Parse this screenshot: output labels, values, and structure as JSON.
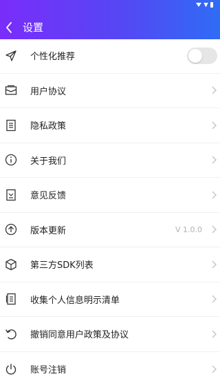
{
  "header": {
    "title": "设置",
    "background": "#5547f4"
  },
  "settings": {
    "items": [
      {
        "label": "个性化推荐",
        "icon": "paper-plane-icon",
        "control": "toggle",
        "toggle_on": false
      },
      {
        "label": "用户协议",
        "icon": "envelope-icon",
        "control": "chevron"
      },
      {
        "label": "隐私政策",
        "icon": "document-icon",
        "control": "chevron"
      },
      {
        "label": "关于我们",
        "icon": "info-icon",
        "control": "chevron"
      },
      {
        "label": "意见反馈",
        "icon": "feedback-icon",
        "control": "chevron"
      },
      {
        "label": "版本更新",
        "icon": "upload-arrow-icon",
        "control": "chevron",
        "value": "V 1.0.0"
      },
      {
        "label": "第三方SDK列表",
        "icon": "cube-icon",
        "control": "chevron"
      },
      {
        "label": "收集个人信息明示清单",
        "icon": "list-document-icon",
        "control": "chevron"
      },
      {
        "label": "撤销同意用户政策及协议",
        "icon": "undo-icon",
        "control": "chevron"
      },
      {
        "label": "账号注销",
        "icon": "power-icon",
        "control": "chevron"
      }
    ]
  }
}
